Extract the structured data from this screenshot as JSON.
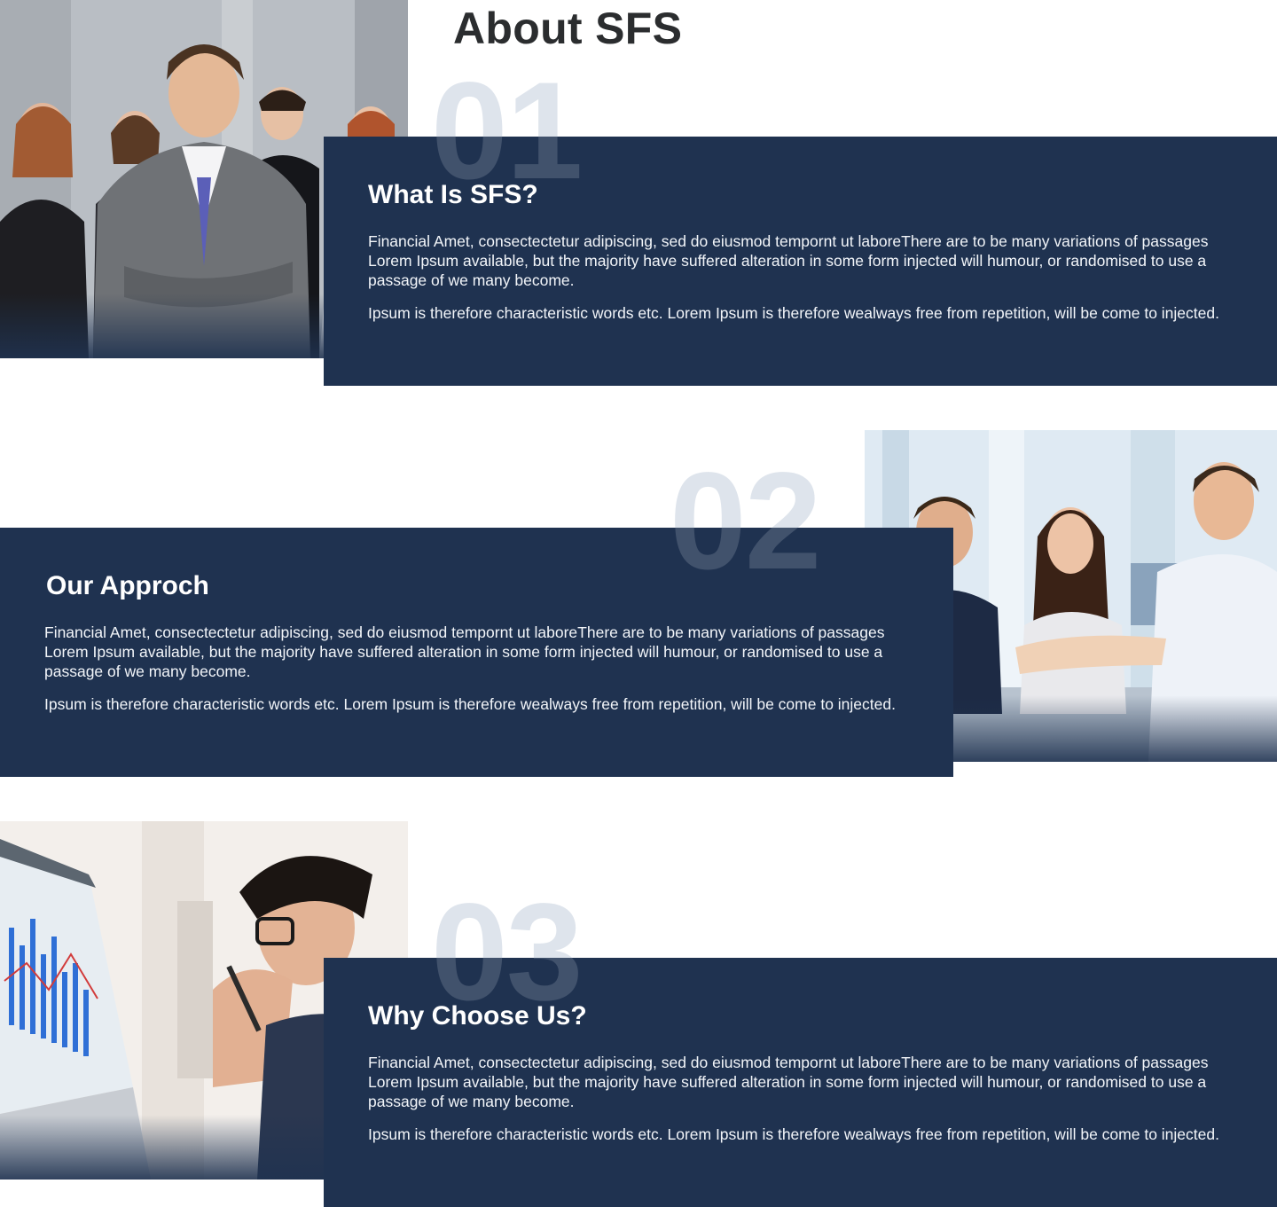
{
  "page": {
    "title": "About SFS"
  },
  "sections": [
    {
      "number": "01",
      "heading": "What Is SFS?",
      "paragraphs": [
        "Financial Amet, consectectetur adipiscing, sed do eiusmod tempornt ut laboreThere are to be many variations of passages  Lorem Ipsum available, but the majority have suffered alteration in some form injected will  humour, or randomised  to use a passage of  we many become.",
        "Ipsum is therefore characteristic words etc. Lorem Ipsum is therefore  wealways free from repetition, will be come to injected."
      ]
    },
    {
      "number": "02",
      "heading": "Our Approch",
      "paragraphs": [
        "Financial Amet, consectectetur adipiscing, sed do eiusmod tempornt ut laboreThere are to be many variations of passages  Lorem Ipsum available, but the majority have suffered alteration in some form injected will  humour, or randomised  to use a passage of  we many become.",
        "Ipsum is therefore characteristic words etc. Lorem Ipsum is therefore  wealways free from repetition, will be come to injected."
      ]
    },
    {
      "number": "03",
      "heading": "Why Choose Us?",
      "paragraphs": [
        "Financial Amet, consectectetur adipiscing, sed do eiusmod tempornt ut laboreThere are to be many variations of passages  Lorem Ipsum available, but the majority have suffered alteration in some form injected will  humour, or randomised  to use a passage of  we many become.",
        "Ipsum is therefore characteristic words etc. Lorem Ipsum is therefore  wealways free from repetition, will be come to injected."
      ]
    }
  ],
  "colors": {
    "panel": "#1f3250",
    "heading_text": "#2b2d2f",
    "big_number": "#dfe5ec"
  }
}
